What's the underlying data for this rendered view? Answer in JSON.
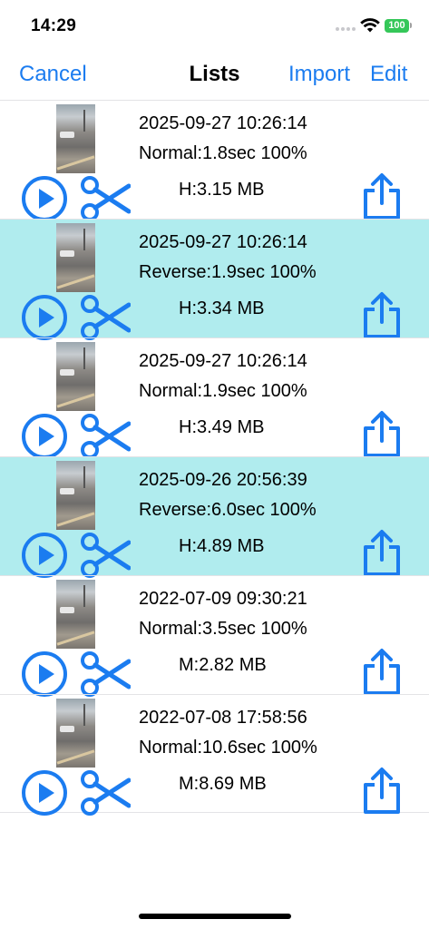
{
  "status_bar": {
    "time": "14:29",
    "battery": "100"
  },
  "nav": {
    "cancel": "Cancel",
    "title": "Lists",
    "import": "Import",
    "edit": "Edit"
  },
  "colors": {
    "accent": "#1b7cf0",
    "highlight_row": "#b0ecee",
    "battery": "#35c759"
  },
  "icons": {
    "play": "play-circle-icon",
    "cut": "scissors-icon",
    "share": "share-icon"
  },
  "rows": [
    {
      "date": "2025-09-27 10:26:14",
      "mode": "Normal:1.8sec 100%",
      "size": "H:3.15 MB",
      "highlighted": false
    },
    {
      "date": "2025-09-27 10:26:14",
      "mode": "Reverse:1.9sec 100%",
      "size": "H:3.34 MB",
      "highlighted": true
    },
    {
      "date": "2025-09-27 10:26:14",
      "mode": "Normal:1.9sec 100%",
      "size": "H:3.49 MB",
      "highlighted": false
    },
    {
      "date": "2025-09-26 20:56:39",
      "mode": "Reverse:6.0sec 100%",
      "size": "H:4.89 MB",
      "highlighted": true
    },
    {
      "date": "2022-07-09 09:30:21",
      "mode": "Normal:3.5sec 100%",
      "size": "M:2.82 MB",
      "highlighted": false
    },
    {
      "date": "2022-07-08 17:58:56",
      "mode": "Normal:10.6sec 100%",
      "size": "M:8.69 MB",
      "highlighted": false
    }
  ]
}
